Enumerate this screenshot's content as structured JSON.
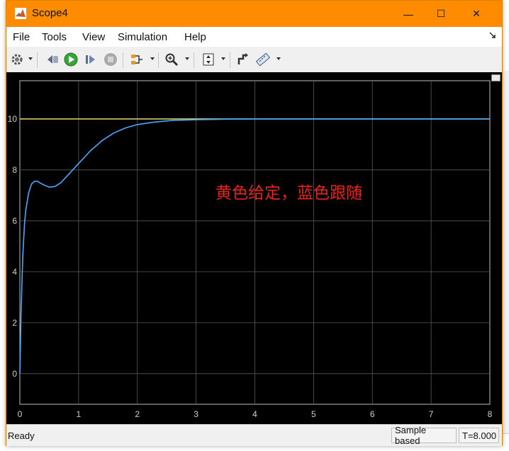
{
  "window": {
    "title": "Scope4",
    "title_bar_color": "#ff8c00",
    "controls": {
      "minimize": "—",
      "maximize": "☐",
      "close": "✕"
    }
  },
  "menu": {
    "items": [
      "File",
      "Tools",
      "View",
      "Simulation",
      "Help"
    ],
    "pin_icon": "pin-icon"
  },
  "toolbar": {
    "tools": [
      "settings-gear-icon",
      "step-back-icon",
      "run-icon",
      "step-forward-icon",
      "stop-icon",
      "signal-selector-icon",
      "zoom-in-icon",
      "autoscale-icon",
      "highlight-block-icon",
      "measurement-ruler-icon"
    ]
  },
  "plot": {
    "annotation": "黄色给定，蓝色跟随",
    "annotation_color": "#e8231e",
    "background": "#000000",
    "axes_background": "#000000",
    "grid_color": "#5a5a5a",
    "tick_color": "#cfcfcf"
  },
  "chart_data": {
    "type": "line",
    "xlim": [
      0,
      8
    ],
    "ylim": [
      -1.2,
      11.5
    ],
    "x_ticks": [
      0,
      1,
      2,
      3,
      4,
      5,
      6,
      7,
      8
    ],
    "y_ticks": [
      0,
      2,
      4,
      6,
      8,
      10
    ],
    "grid": true,
    "series": [
      {
        "color": "#e6d96e",
        "x": [
          0,
          8
        ],
        "y": [
          10,
          10
        ]
      },
      {
        "color": "#4aa8ff",
        "x": [
          0,
          0.02,
          0.05,
          0.08,
          0.1,
          0.15,
          0.2,
          0.25,
          0.3,
          0.35,
          0.4,
          0.5,
          0.6,
          0.7,
          0.8,
          0.9,
          1.0,
          1.2,
          1.4,
          1.6,
          1.8,
          2.0,
          2.3,
          2.6,
          3.0,
          3.5,
          4.0,
          4.5,
          5.0,
          6.0,
          7.0,
          8.0
        ],
        "y": [
          0,
          2.4,
          4.6,
          5.9,
          6.4,
          7.1,
          7.45,
          7.55,
          7.55,
          7.48,
          7.42,
          7.32,
          7.35,
          7.5,
          7.75,
          8.0,
          8.25,
          8.75,
          9.15,
          9.45,
          9.65,
          9.78,
          9.88,
          9.94,
          9.97,
          9.99,
          10.0,
          10.0,
          10.0,
          10.0,
          10.0,
          10.0
        ]
      }
    ]
  },
  "status": {
    "left": "Ready",
    "sample_mode": "Sample based",
    "time": "T=8.000"
  }
}
